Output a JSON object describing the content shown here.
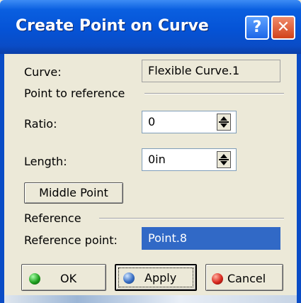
{
  "window": {
    "title": "Create Point on Curve",
    "help_glyph": "?",
    "close_glyph": "✕"
  },
  "curve": {
    "label": "Curve:",
    "value": "Flexible Curve.1"
  },
  "point_to_reference": {
    "group_label": "Point to reference",
    "ratio_label": "Ratio:",
    "ratio_value": "0",
    "length_label": "Length:",
    "length_value": "0in",
    "middle_point_label": "Middle Point"
  },
  "reference": {
    "group_label": "Reference",
    "point_label": "Reference point:",
    "point_value": "Point.8"
  },
  "buttons": {
    "ok": "OK",
    "apply": "Apply",
    "cancel": "Cancel"
  },
  "colors": {
    "titlebar": "#0553d6",
    "selection": "#3169c6",
    "dialog_bg": "#ece9d8"
  }
}
